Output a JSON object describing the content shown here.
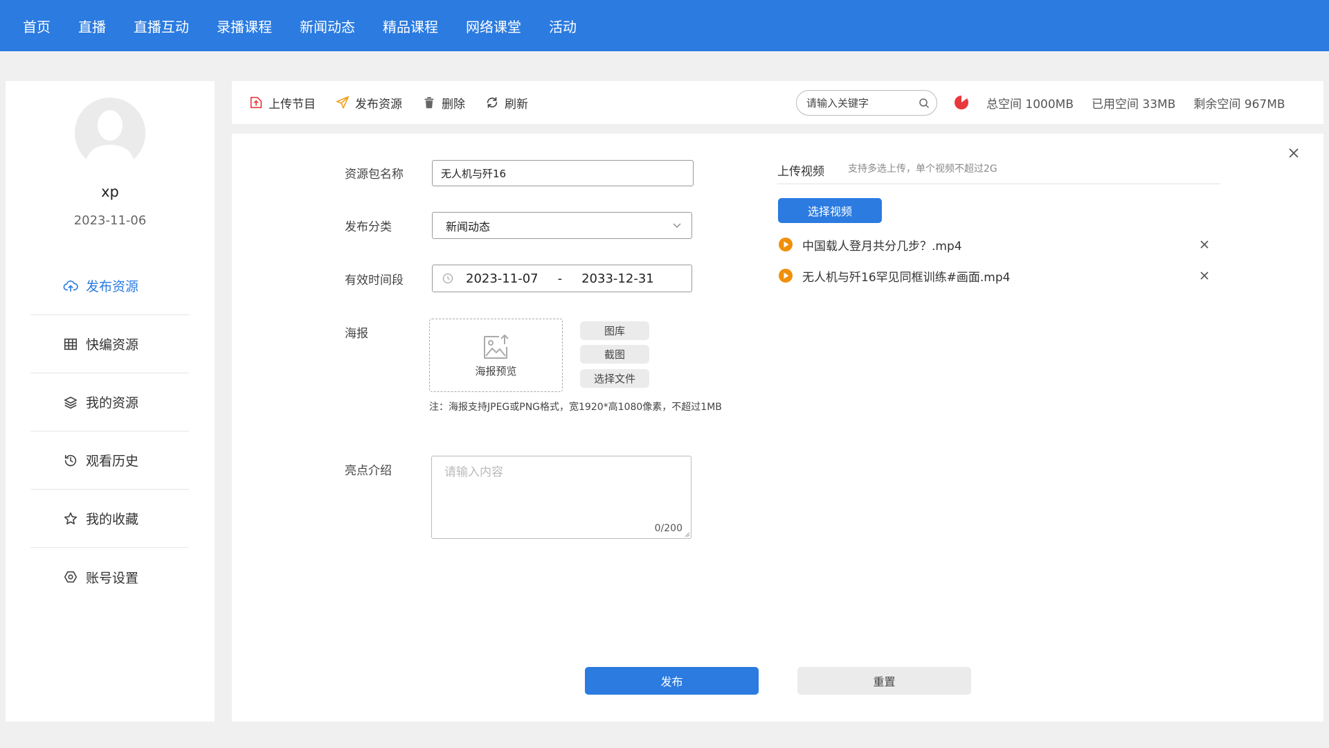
{
  "nav": {
    "items": [
      "首页",
      "直播",
      "直播互动",
      "录播课程",
      "新闻动态",
      "精品课程",
      "网络课堂",
      "活动"
    ]
  },
  "user": {
    "name": "xp",
    "date": "2023-11-06"
  },
  "sidebar": {
    "items": [
      {
        "label": "发布资源",
        "icon": "cloud-upload-icon",
        "active": true
      },
      {
        "label": "快编资源",
        "icon": "grid-icon",
        "active": false
      },
      {
        "label": "我的资源",
        "icon": "layers-icon",
        "active": false
      },
      {
        "label": "观看历史",
        "icon": "history-icon",
        "active": false
      },
      {
        "label": "我的收藏",
        "icon": "star-icon",
        "active": false
      },
      {
        "label": "账号设置",
        "icon": "settings-icon",
        "active": false
      }
    ]
  },
  "toolbar": {
    "upload_label": "上传节目",
    "publish_label": "发布资源",
    "delete_label": "删除",
    "refresh_label": "刷新",
    "search_placeholder": "请输入关键字",
    "total_space": "总空间 1000MB",
    "used_space": "已用空间 33MB",
    "free_space": "剩余空间 967MB"
  },
  "form": {
    "name_label": "资源包名称",
    "name_value": "无人机与歼16",
    "category_label": "发布分类",
    "category_value": "新闻动态",
    "period_label": "有效时间段",
    "period_start": "2023-11-07",
    "period_sep": "-",
    "period_end": "2033-12-31",
    "poster_label": "海报",
    "poster_preview": "海报预览",
    "btn_gallery": "图库",
    "btn_screenshot": "截图",
    "btn_choose_file": "选择文件",
    "poster_note": "注：海报支持JPEG或PNG格式，宽1920*高1080像素，不超过1MB",
    "highlight_label": "亮点介绍",
    "highlight_placeholder": "请输入内容",
    "highlight_counter": "0/200",
    "publish_button": "发布",
    "reset_button": "重置"
  },
  "upload": {
    "title": "上传视频",
    "hint": "支持多选上传，单个视频不超过2G",
    "choose_button": "选择视频",
    "files": [
      "中国载人登月共分几步？.mp4",
      "无人机与歼16罕见同框训练#画面.mp4"
    ]
  },
  "colors": {
    "primary": "#2b7be0",
    "accent_red": "#e8383d",
    "play_orange": "#f0900a"
  }
}
